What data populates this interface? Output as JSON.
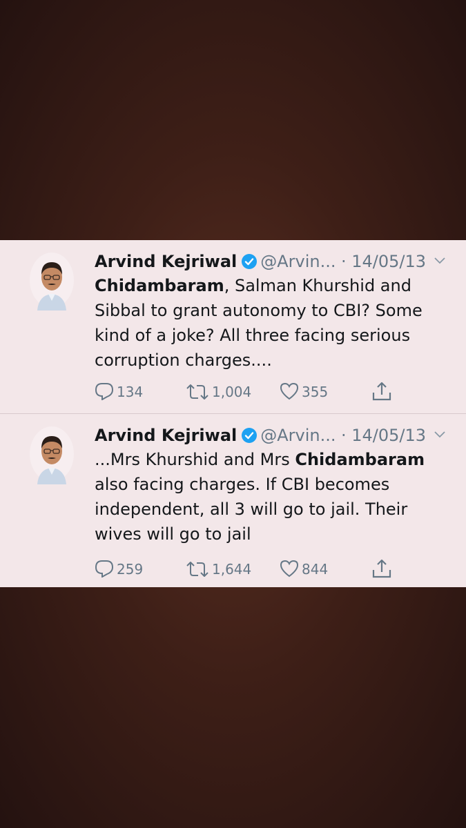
{
  "tweets": [
    {
      "name": "Arvind Kejriwal",
      "handle": "@Arvin...",
      "date": "· 14/05/13",
      "text_bold_1": "Chidambaram",
      "text_1": ", Salman Khurshid and Sibbal to grant autonomy to CBI? Some kind of a joke? All three facing serious corruption charges....",
      "replies": "134",
      "retweets": "1,004",
      "likes": "355"
    },
    {
      "name": "Arvind Kejriwal",
      "handle": "@Arvin...",
      "date": "· 14/05/13",
      "text_pre": "...Mrs Khurshid and Mrs ",
      "text_bold": "Chidambaram",
      "text_post": " also facing charges. If CBI becomes independent, all 3 will go to jail. Their wives will go to jail",
      "replies": "259",
      "retweets": "1,644",
      "likes": "844"
    }
  ],
  "icons": {
    "verified": "verified-badge-icon",
    "chevron": "chevron-down-icon",
    "reply": "reply-icon",
    "retweet": "retweet-icon",
    "like": "heart-icon",
    "share": "share-icon"
  },
  "colors": {
    "card_bg": "#f3e7e9",
    "verified_blue": "#1da1f2",
    "muted": "#657786",
    "text": "#14171a"
  }
}
